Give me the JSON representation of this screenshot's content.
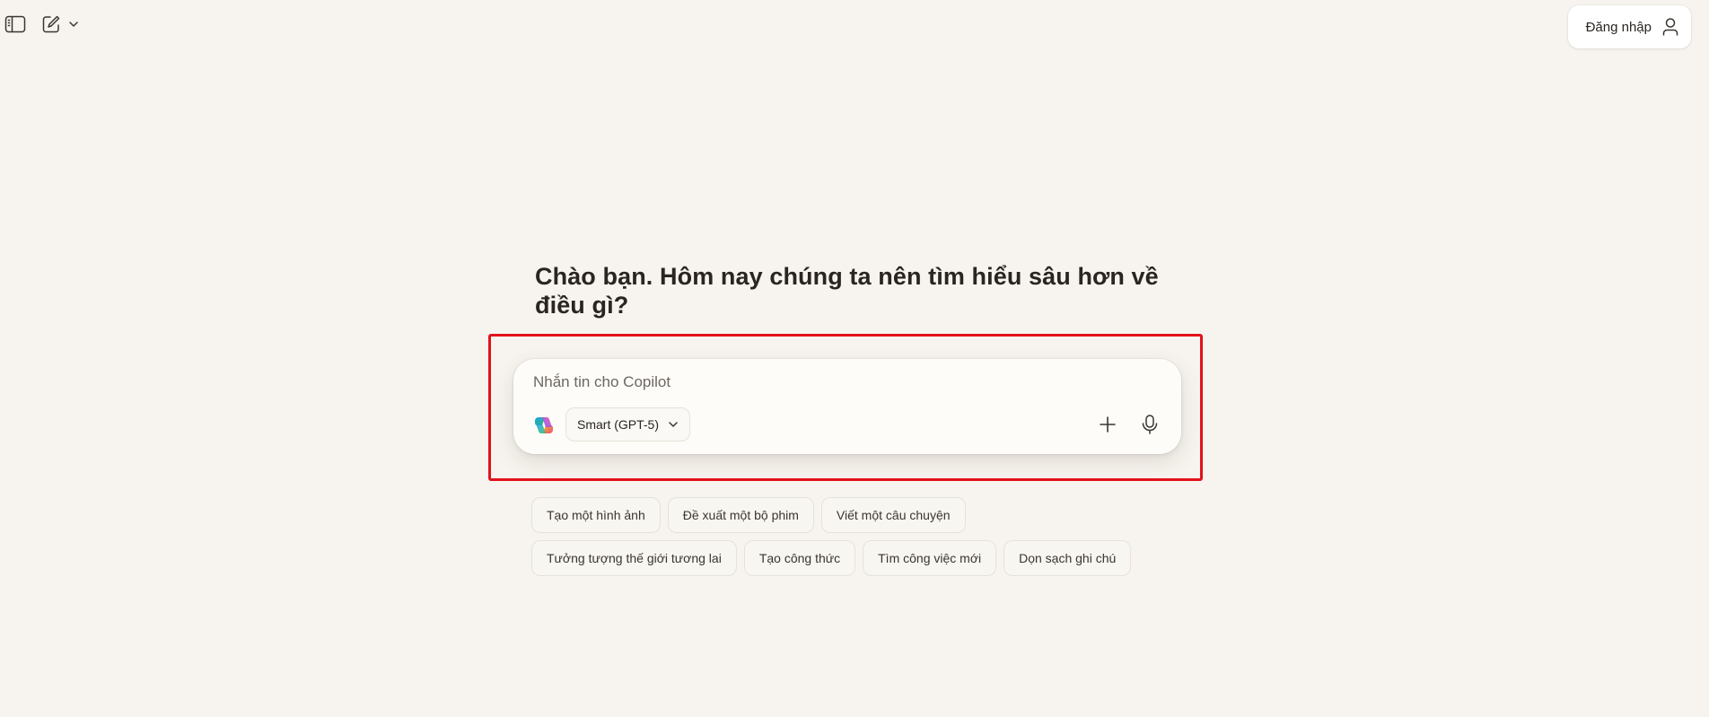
{
  "topbar": {
    "sidebar_icon": "sidebar-toggle-icon",
    "new_chat_icon": "compose-icon",
    "menu_icon": "chevron-down-icon"
  },
  "signin": {
    "label": "Đăng nhập",
    "icon": "user-icon"
  },
  "greeting": {
    "text": "Chào bạn. Hôm nay chúng ta nên tìm hiểu sâu hơn về điều gì?"
  },
  "composer": {
    "placeholder": "Nhắn tin cho Copilot",
    "value": "",
    "logo_icon": "copilot-logo-icon",
    "model": "Smart (GPT-5)",
    "add_icon": "plus-icon",
    "mic_icon": "microphone-icon"
  },
  "suggestions": {
    "row1": [
      {
        "label": "Tạo một hình ảnh"
      },
      {
        "label": "Đề xuất một bộ phim"
      },
      {
        "label": "Viết một câu chuyện"
      }
    ],
    "row2": [
      {
        "label": "Tưởng tượng thế giới tương lai"
      },
      {
        "label": "Tạo công thức"
      },
      {
        "label": "Tìm công việc mới"
      },
      {
        "label": "Dọn sạch ghi chú"
      }
    ]
  },
  "colors": {
    "background": "#f7f4ef",
    "highlight_border": "#e2121b",
    "text": "#2b2522"
  }
}
